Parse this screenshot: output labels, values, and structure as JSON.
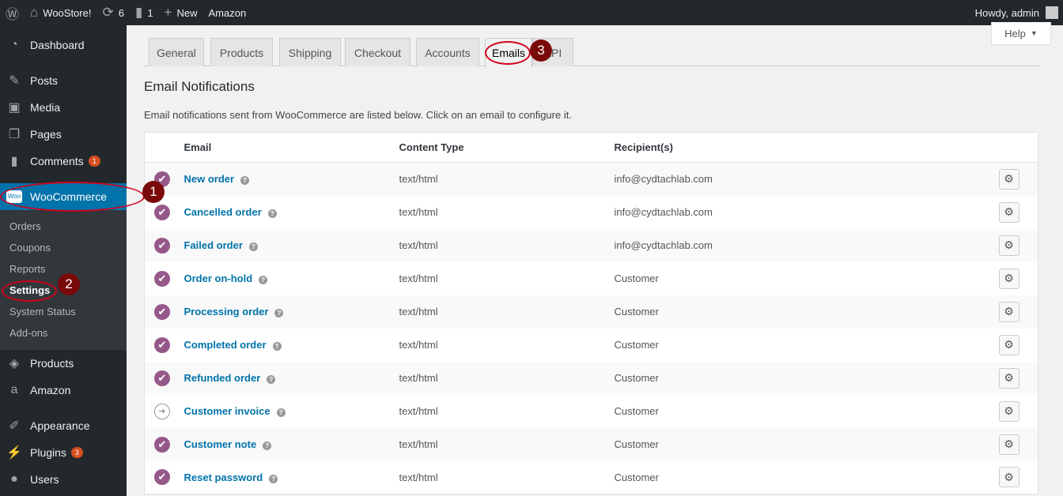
{
  "admin_bar": {
    "site": "WooStore!",
    "updates": "6",
    "comments": "1",
    "new": "New",
    "amazon": "Amazon",
    "howdy": "Howdy, admin"
  },
  "sidebar": {
    "items": [
      {
        "label": "Dashboard"
      },
      {
        "label": "Posts"
      },
      {
        "label": "Media"
      },
      {
        "label": "Pages"
      },
      {
        "label": "Comments",
        "badge": "1"
      },
      {
        "label": "WooCommerce"
      },
      {
        "label": "Products"
      },
      {
        "label": "Amazon"
      },
      {
        "label": "Appearance"
      },
      {
        "label": "Plugins",
        "badge": "3"
      },
      {
        "label": "Users"
      }
    ],
    "submenu": [
      "Orders",
      "Coupons",
      "Reports",
      "Settings",
      "System Status",
      "Add-ons"
    ]
  },
  "help": "Help",
  "tabs": [
    "General",
    "Products",
    "Shipping",
    "Checkout",
    "Accounts",
    "Emails",
    "API"
  ],
  "title": "Email Notifications",
  "description": "Email notifications sent from WooCommerce are listed below. Click on an email to configure it.",
  "table": {
    "headers": [
      "Email",
      "Content Type",
      "Recipient(s)"
    ],
    "rows": [
      {
        "name": "New order",
        "type": "text/html",
        "recipient": "info@cydtachlab.com",
        "enabled": true
      },
      {
        "name": "Cancelled order",
        "type": "text/html",
        "recipient": "info@cydtachlab.com",
        "enabled": true
      },
      {
        "name": "Failed order",
        "type": "text/html",
        "recipient": "info@cydtachlab.com",
        "enabled": true
      },
      {
        "name": "Order on-hold",
        "type": "text/html",
        "recipient": "Customer",
        "enabled": true
      },
      {
        "name": "Processing order",
        "type": "text/html",
        "recipient": "Customer",
        "enabled": true
      },
      {
        "name": "Completed order",
        "type": "text/html",
        "recipient": "Customer",
        "enabled": true
      },
      {
        "name": "Refunded order",
        "type": "text/html",
        "recipient": "Customer",
        "enabled": true
      },
      {
        "name": "Customer invoice",
        "type": "text/html",
        "recipient": "Customer",
        "enabled": false
      },
      {
        "name": "Customer note",
        "type": "text/html",
        "recipient": "Customer",
        "enabled": true
      },
      {
        "name": "Reset password",
        "type": "text/html",
        "recipient": "Customer",
        "enabled": true
      }
    ]
  },
  "annotations": [
    "1",
    "2",
    "3"
  ]
}
